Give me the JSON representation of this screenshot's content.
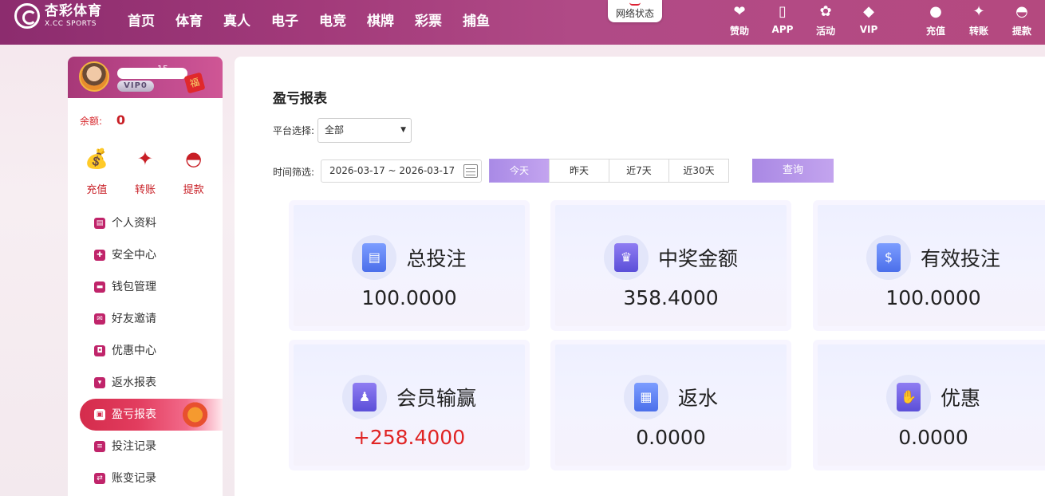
{
  "brand": {
    "name_cn": "杏彩体育",
    "name_en": "X.CC SPORTS"
  },
  "nav": [
    {
      "label": "首页"
    },
    {
      "label": "体育"
    },
    {
      "label": "真人"
    },
    {
      "label": "电子"
    },
    {
      "label": "电竞"
    },
    {
      "label": "棋牌"
    },
    {
      "label": "彩票"
    },
    {
      "label": "捕鱼"
    }
  ],
  "network_status": "网络状态",
  "top_actions_left": [
    {
      "label": "赞助",
      "icon": "heart-handshake-icon"
    },
    {
      "label": "APP",
      "icon": "phone-icon"
    },
    {
      "label": "活动",
      "icon": "gift-icon"
    },
    {
      "label": "VIP",
      "icon": "diamond-icon"
    }
  ],
  "top_actions_right": [
    {
      "label": "充值",
      "icon": "money-bag-icon"
    },
    {
      "label": "转账",
      "icon": "transfer-icon"
    },
    {
      "label": "提款",
      "icon": "fan-icon"
    }
  ],
  "user": {
    "username": "15",
    "vip": "VIP0",
    "balance_label": "余额:",
    "balance_value": "0"
  },
  "wallet": [
    {
      "label": "充值",
      "icon": "money-bag-icon"
    },
    {
      "label": "转账",
      "icon": "transfer-icon"
    },
    {
      "label": "提款",
      "icon": "fan-icon"
    }
  ],
  "menu": [
    {
      "label": "个人资料",
      "icon": "profile-card-icon",
      "active": false
    },
    {
      "label": "安全中心",
      "icon": "shield-icon",
      "active": false
    },
    {
      "label": "钱包管理",
      "icon": "wallet-icon",
      "active": false
    },
    {
      "label": "好友邀请",
      "icon": "envelope-icon",
      "active": false
    },
    {
      "label": "优惠中心",
      "icon": "ticket-icon",
      "active": false
    },
    {
      "label": "返水报表",
      "icon": "cup-icon",
      "active": false
    },
    {
      "label": "盈亏报表",
      "icon": "report-icon",
      "active": true
    },
    {
      "label": "投注记录",
      "icon": "list-icon",
      "active": false
    },
    {
      "label": "账变记录",
      "icon": "exchange-icon",
      "active": false
    }
  ],
  "main": {
    "title": "盈亏报表",
    "platform_label": "平台选择:",
    "platform_value": "全部",
    "time_label": "时间筛选:",
    "date_range": "2026-03-17 ~ 2026-03-17",
    "quick_ranges": [
      {
        "label": "今天",
        "active": true
      },
      {
        "label": "昨天",
        "active": false
      },
      {
        "label": "近7天",
        "active": false
      },
      {
        "label": "近30天",
        "active": false
      }
    ],
    "query_label": "查询"
  },
  "cards": [
    {
      "label": "总投注",
      "value": "100.0000",
      "icon": "document-icon"
    },
    {
      "label": "中奖金额",
      "value": "358.4000",
      "icon": "trophy-receipt-icon"
    },
    {
      "label": "有效投注",
      "value": "100.0000",
      "icon": "cash-receipt-icon"
    },
    {
      "label": "会员输赢",
      "value": "+258.4000",
      "icon": "member-icon"
    },
    {
      "label": "返水",
      "value": "0.0000",
      "icon": "rebate-doc-icon"
    },
    {
      "label": "优惠",
      "value": "0.0000",
      "icon": "hand-coin-icon"
    }
  ],
  "colors": {
    "accent": "#b04a86",
    "active_menu": "#d42c4c",
    "positive": "#e02424",
    "button": "#b298ea"
  }
}
